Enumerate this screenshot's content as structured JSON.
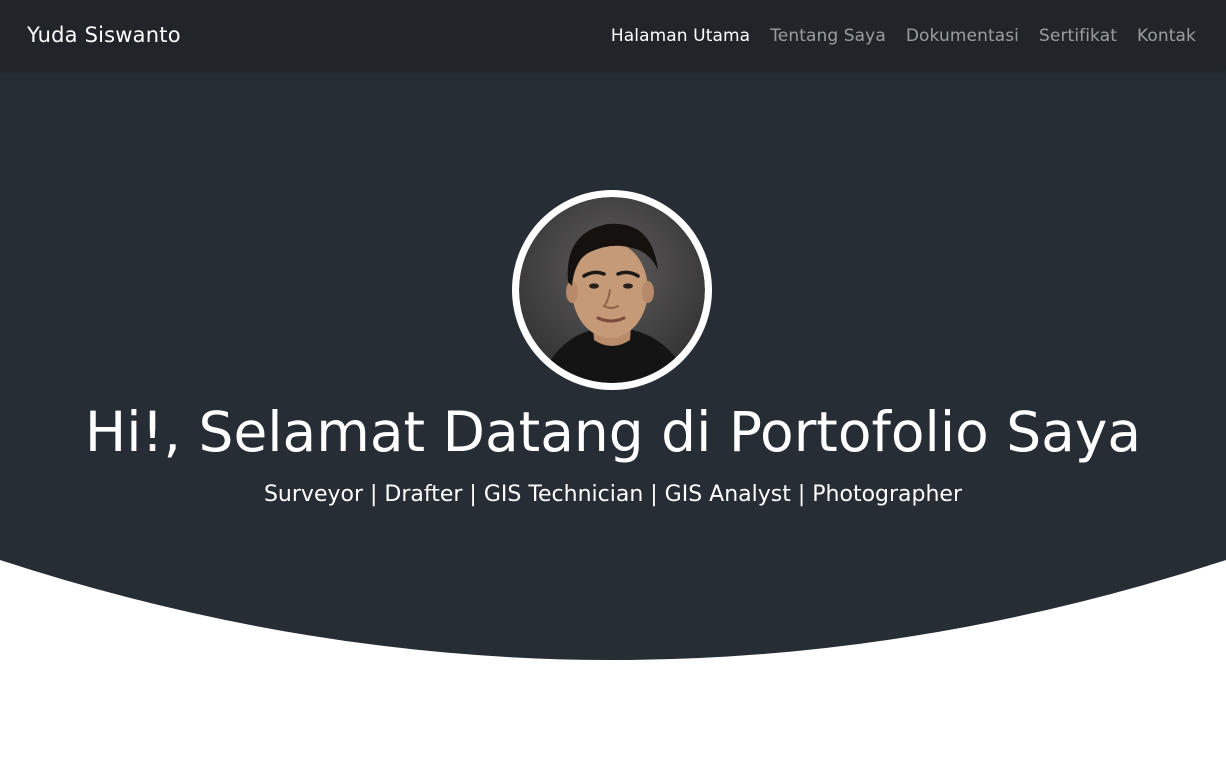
{
  "navbar": {
    "brand": "Yuda Siswanto",
    "links": [
      {
        "label": "Halaman Utama",
        "active": true
      },
      {
        "label": "Tentang Saya",
        "active": false
      },
      {
        "label": "Dokumentasi",
        "active": false
      },
      {
        "label": "Sertifikat",
        "active": false
      },
      {
        "label": "Kontak",
        "active": false
      }
    ]
  },
  "hero": {
    "title": "Hi!, Selamat Datang di Portofolio Saya",
    "subtitle": "Surveyor | Drafter | GIS Technician | GIS Analyst | Photographer"
  },
  "colors": {
    "navbar_bg": "#212529",
    "hero_bg": "#262d35",
    "page_bg": "#ffffff",
    "text_light": "#ffffff",
    "nav_inactive": "rgba(255,255,255,0.55)"
  },
  "icons": {
    "profile_photo": "profile-photo"
  }
}
